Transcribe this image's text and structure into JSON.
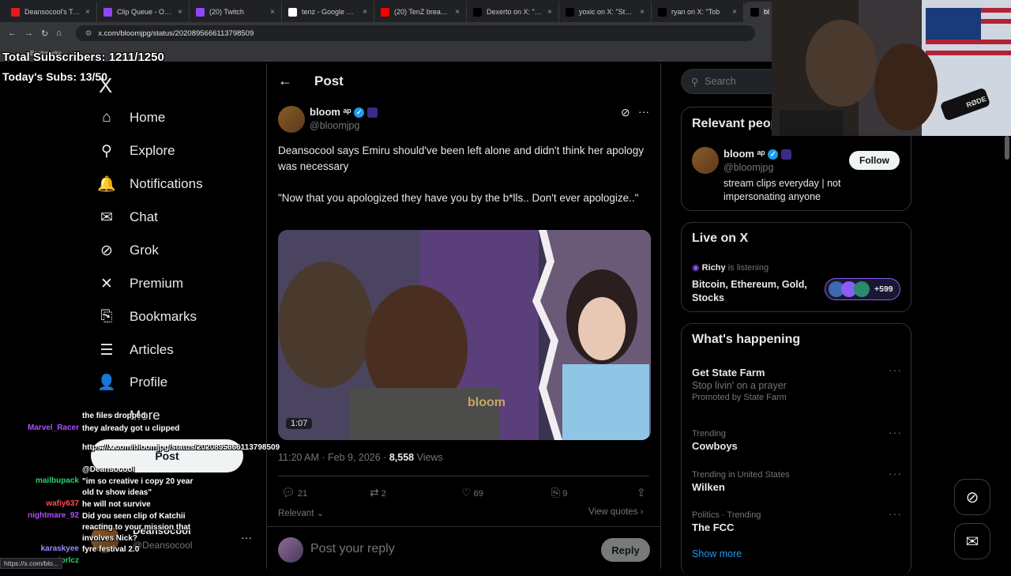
{
  "browser": {
    "tabs": [
      {
        "title": "Deansocool's Twitch",
        "color": "#e91916",
        "close": "×"
      },
      {
        "title": "Clip Queue - Open",
        "color": "#9146ff",
        "close": "×"
      },
      {
        "title": "(20) Twitch",
        "color": "#9146ff",
        "close": "×"
      },
      {
        "title": "tenz - Google Search",
        "color": "#ffffff",
        "close": "×"
      },
      {
        "title": "(20) TenZ breaks up",
        "color": "#ff0000",
        "close": "×"
      },
      {
        "title": "Dexerto on X: \"Strea",
        "color": "#000000",
        "close": "×"
      },
      {
        "title": "yoxic on X: \"StableR",
        "color": "#000000",
        "close": "×"
      },
      {
        "title": "ryan on X: \"Tob",
        "color": "#000000",
        "close": "×"
      },
      {
        "title": "bl",
        "color": "#000000",
        "close": ""
      }
    ],
    "url": "x.com/bloomjpg/status/2020895666113798509",
    "bookmarks_label": "Bookmarks",
    "status_url": "https://x.com/blo..."
  },
  "stream_overlay": {
    "total_subs": "Total Subscribers: 1211/1250",
    "today_subs": "Today's Subs: 13/50"
  },
  "left_nav": {
    "logo": "X",
    "items": [
      {
        "label": "Home",
        "icon": "home-icon",
        "glyph": "⌂"
      },
      {
        "label": "Explore",
        "icon": "search-icon",
        "glyph": "⚲"
      },
      {
        "label": "Notifications",
        "icon": "bell-icon",
        "glyph": "🔔"
      },
      {
        "label": "Chat",
        "icon": "mail-icon",
        "glyph": "✉"
      },
      {
        "label": "Grok",
        "icon": "grok-icon",
        "glyph": "⊘"
      },
      {
        "label": "Premium",
        "icon": "x-icon",
        "glyph": "✕"
      },
      {
        "label": "Bookmarks",
        "icon": "bookmark-icon",
        "glyph": "⎘"
      },
      {
        "label": "Articles",
        "icon": "article-icon",
        "glyph": "☰"
      },
      {
        "label": "Profile",
        "icon": "person-icon",
        "glyph": "👤"
      }
    ],
    "more_label": "More",
    "post_button": "Post",
    "account_name": "Deansocool",
    "account_handle": "@Deansocool",
    "account_more": "···"
  },
  "post": {
    "header_title": "Post",
    "author_name": "bloom ᵃᵖ",
    "author_handle": "@bloomjpg",
    "text_line1": "Deansocool says Emiru should've been left alone and didn't think her apology was necessary",
    "text_line2": "\"Now that you apologized they have you by the b*lls.. Don't ever apologize..\"",
    "video_duration": "1:07",
    "video_watermark": "bloom",
    "timestamp": "11:20 AM · Feb 9, 2026 · ",
    "views_count": "8,558",
    "views_label": " Views",
    "replies": "21",
    "reposts": "2",
    "likes": "69",
    "bookmarks": "9",
    "relevant_label": "Relevant",
    "view_quotes": "View quotes",
    "reply_placeholder": "Post your reply",
    "reply_button": "Reply"
  },
  "sidebar": {
    "search_placeholder": "Search",
    "relevant_title": "Relevant people",
    "relevant_name": "bloom ᵃᵖ",
    "relevant_handle": "@bloomjpg",
    "relevant_bio": "stream clips everyday | not impersonating anyone",
    "follow_label": "Follow",
    "live_title": "Live on X",
    "live_user": "Richy",
    "live_status": " is listening",
    "live_topic": "Bitcoin, Ethereum, Gold, Stocks",
    "live_count": "+599",
    "happening_title": "What's happening",
    "trends": [
      {
        "meta": "",
        "name": "Get State Farm",
        "sub": "Stop livin' on a prayer",
        "promo": "Promoted by State Farm"
      },
      {
        "meta": "Trending",
        "name": "Cowboys",
        "sub": "",
        "promo": ""
      },
      {
        "meta": "Trending in United States",
        "name": "Wilken",
        "sub": "",
        "promo": ""
      },
      {
        "meta": "Politics · Trending",
        "name": "The FCC",
        "sub": "",
        "promo": ""
      }
    ],
    "show_more": "Show more"
  },
  "chat": [
    {
      "user": "",
      "color": "#ffffff",
      "msg": "the files dropped"
    },
    {
      "user": "Marvel_Racer",
      "color": "#b14cff",
      "msg": "they already got u clipped"
    },
    {
      "user": "",
      "color": "#ffffff",
      "msg": "https://x.com/bloomjpg/status/2020895666113798509"
    },
    {
      "user": "",
      "color": "#ffffff",
      "msg": "@Deansocool"
    },
    {
      "user": "mailbupack",
      "color": "#2ecc71",
      "msg": "\"im so creative i copy 20 year old tv show ideas\""
    },
    {
      "user": "wafiy637",
      "color": "#ff4d4d",
      "msg": "he will not survive"
    },
    {
      "user": "nightmare_92",
      "color": "#b14cff",
      "msg": "Did you seen clip of Katchii reacting to your mission that involves Nick?"
    },
    {
      "user": "karaskyee",
      "color": "#9b8cff",
      "msg": "fyre festival 2.0"
    },
    {
      "user": "vjprlcz",
      "color": "#2ecc71",
      "msg": ""
    }
  ],
  "floating": {
    "grok_icon": "grok-icon",
    "messages_icon": "mail-icon"
  },
  "webcam": {
    "mic_label": "RØDE"
  }
}
